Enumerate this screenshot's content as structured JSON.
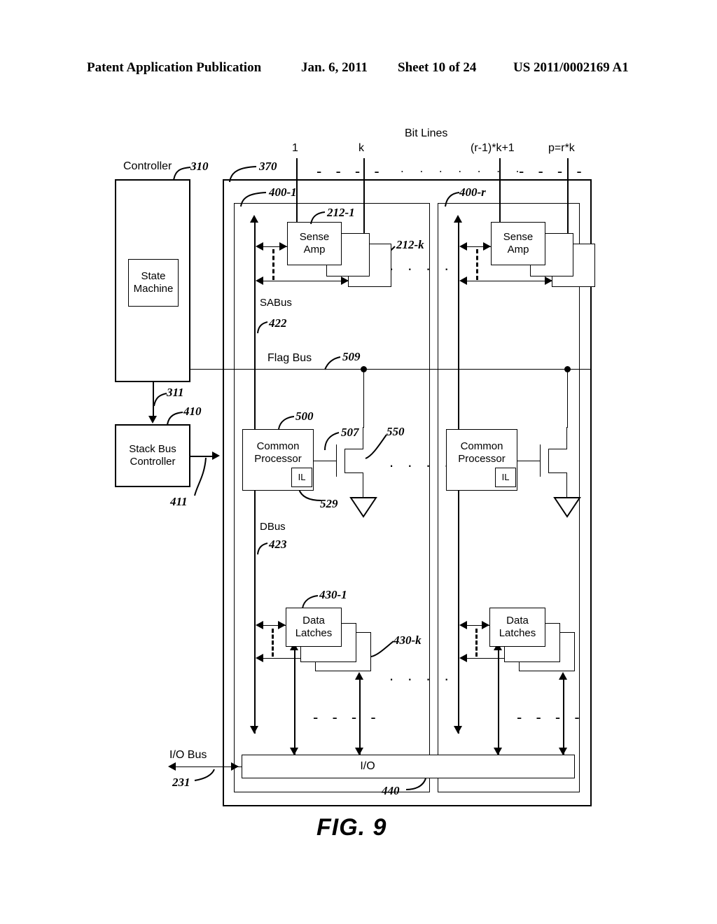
{
  "header": {
    "publication": "Patent Application Publication",
    "date": "Jan. 6, 2011",
    "sheet": "Sheet 10 of 24",
    "number": "US 2011/0002169 A1"
  },
  "figure": {
    "caption": "FIG. 9"
  },
  "diagram": {
    "bit_lines": {
      "title": "Bit Lines",
      "labels": {
        "first": "1",
        "k": "k",
        "rk1": "(r-1)*k+1",
        "p": "p=r*k"
      },
      "dash_left": "- - - -",
      "dash_right": "- - - -",
      "dots_center": ". . . . . . ."
    },
    "controller": {
      "label": "Controller",
      "ref": "310",
      "state_machine": "State\nMachine",
      "out_ref": "311"
    },
    "stack_bus_controller": {
      "label": "Stack Bus\nController",
      "ref": "410",
      "out_ref": "411"
    },
    "read_write_stack_bank": {
      "ref": "370"
    },
    "stacks": [
      {
        "ref": "400-1",
        "sense_amp": {
          "label": "Sense\nAmp",
          "ref_first": "212-1",
          "ref_last": "212-k",
          "dots": ". . . ."
        },
        "sabus": {
          "label": "SABus",
          "ref": "422"
        },
        "common_processor": {
          "label": "Common\nProcessor",
          "ref": "500",
          "il_label": "IL",
          "il_ref": "529",
          "transistor_ref": "507",
          "pulldown_ref": "550",
          "dots": ". . . ."
        },
        "dbus": {
          "label": "DBus",
          "ref": "423"
        },
        "data_latches": {
          "label": "Data\nLatches",
          "ref_first": "430-1",
          "ref_last": "430-k",
          "dots": ". . . ."
        },
        "bottom_dash": "- - - -"
      },
      {
        "ref": "400-r",
        "sense_amp": {
          "label": "Sense\nAmp",
          "ref_first": "",
          "ref_last": "",
          "dots": ""
        },
        "sabus": {
          "label": "",
          "ref": ""
        },
        "common_processor": {
          "label": "Common\nProcessor",
          "ref": "",
          "il_label": "IL",
          "il_ref": "",
          "transistor_ref": "",
          "pulldown_ref": "",
          "dots": ""
        },
        "dbus": {
          "label": "",
          "ref": ""
        },
        "data_latches": {
          "label": "Data\nLatches",
          "ref_first": "",
          "ref_last": "",
          "dots": ""
        },
        "bottom_dash": "- - - -"
      }
    ],
    "flag_bus": {
      "label": "Flag Bus",
      "ref": "509"
    },
    "io": {
      "block_label": "I/O",
      "block_ref": "440",
      "bus_label": "I/O Bus",
      "bus_ref": "231"
    }
  }
}
